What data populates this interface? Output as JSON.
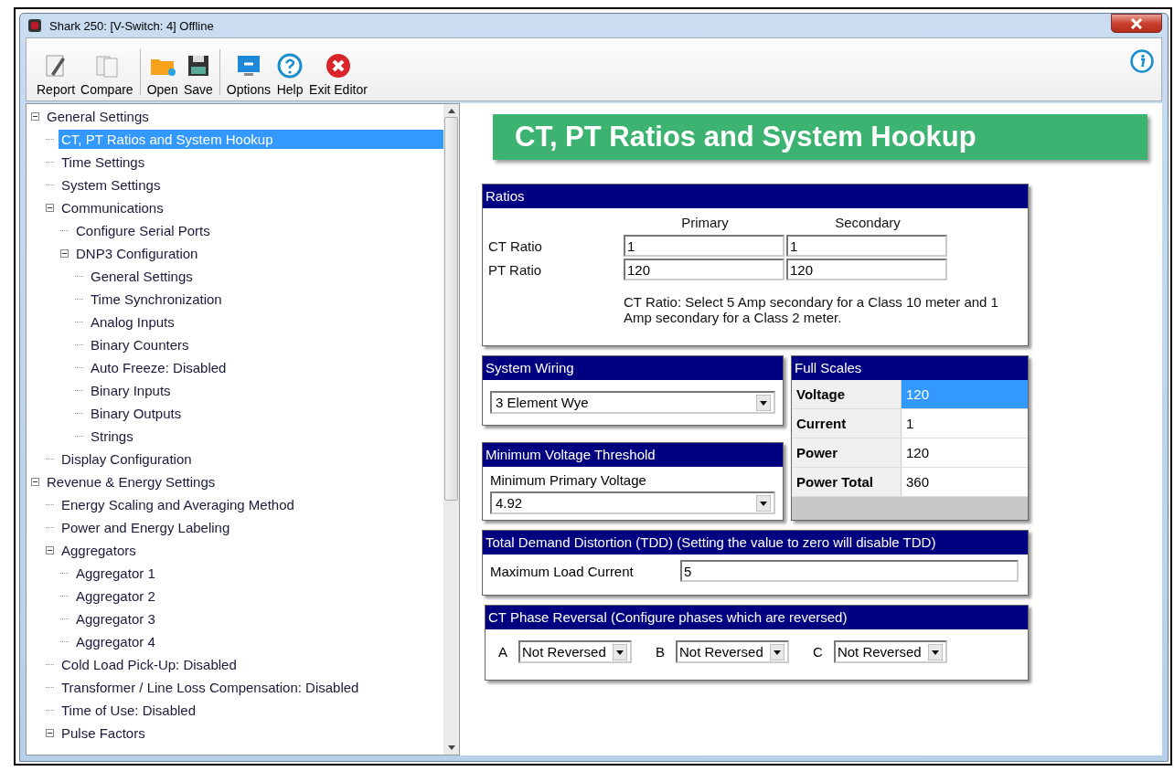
{
  "window": {
    "title": "Shark 250: [V-Switch: 4] Offline"
  },
  "toolbar": {
    "groups": [
      [
        {
          "label": "Report",
          "kind": "report"
        },
        {
          "label": "Compare",
          "kind": "compare"
        }
      ],
      [
        {
          "label": "Open",
          "kind": "open"
        },
        {
          "label": "Save",
          "kind": "save"
        }
      ],
      [
        {
          "label": "Options",
          "kind": "options"
        },
        {
          "label": "Help",
          "kind": "help"
        },
        {
          "label": "Exit Editor",
          "kind": "exit"
        }
      ]
    ]
  },
  "tree": [
    {
      "label": "General Settings",
      "expanded": true,
      "selected": false,
      "children": [
        {
          "label": "CT, PT Ratios and System Hookup",
          "selected": true
        },
        {
          "label": "Time Settings",
          "selected": false
        },
        {
          "label": "System Settings",
          "selected": false
        },
        {
          "label": "Communications",
          "expanded": true,
          "selected": false,
          "children": [
            {
              "label": "Configure Serial Ports",
              "selected": false
            },
            {
              "label": "DNP3 Configuration",
              "expanded": true,
              "selected": false,
              "children": [
                {
                  "label": "General Settings",
                  "selected": false
                },
                {
                  "label": "Time Synchronization",
                  "selected": false
                },
                {
                  "label": "Analog Inputs",
                  "selected": false
                },
                {
                  "label": "Binary Counters",
                  "selected": false
                },
                {
                  "label": "Auto Freeze: Disabled",
                  "selected": false
                },
                {
                  "label": "Binary Inputs",
                  "selected": false
                },
                {
                  "label": "Binary Outputs",
                  "selected": false
                },
                {
                  "label": "Strings",
                  "selected": false
                }
              ]
            }
          ]
        },
        {
          "label": "Display Configuration",
          "selected": false
        }
      ]
    },
    {
      "label": "Revenue & Energy Settings",
      "expanded": true,
      "selected": false,
      "children": [
        {
          "label": "Energy Scaling and Averaging Method",
          "selected": false
        },
        {
          "label": "Power and Energy Labeling",
          "selected": false
        },
        {
          "label": "Aggregators",
          "expanded": true,
          "selected": false,
          "children": [
            {
              "label": "Aggregator 1",
              "selected": false
            },
            {
              "label": "Aggregator 2",
              "selected": false
            },
            {
              "label": "Aggregator 3",
              "selected": false
            },
            {
              "label": "Aggregator 4",
              "selected": false
            }
          ]
        },
        {
          "label": "Cold Load Pick-Up: Disabled",
          "selected": false
        },
        {
          "label": "Transformer / Line Loss Compensation: Disabled",
          "selected": false
        },
        {
          "label": "Time of Use: Disabled",
          "selected": false
        },
        {
          "label": "Pulse Factors",
          "expanded": true,
          "selected": false
        }
      ]
    }
  ],
  "page_title": "CT, PT Ratios and System Hookup",
  "ratios": {
    "title": "Ratios",
    "columns": [
      "Primary",
      "Secondary"
    ],
    "rows": [
      {
        "label": "CT Ratio",
        "values": [
          "1",
          "1"
        ]
      },
      {
        "label": "PT Ratio",
        "values": [
          "120",
          "120"
        ]
      }
    ],
    "note": "CT Ratio: Select 5 Amp secondary for a Class 10 meter and 1 Amp secondary for a Class 2 meter."
  },
  "system_wiring": {
    "title": "System Wiring",
    "value": "3 Element Wye"
  },
  "full_scales": {
    "title": "Full Scales",
    "rows": [
      {
        "label": "Voltage",
        "value": "120",
        "selected": true
      },
      {
        "label": "Current",
        "value": "1",
        "selected": false
      },
      {
        "label": "Power",
        "value": "120",
        "selected": false
      },
      {
        "label": "Power Total",
        "value": "360",
        "selected": false
      }
    ]
  },
  "min_voltage": {
    "title": "Minimum Voltage Threshold",
    "label": "Minimum Primary Voltage",
    "value": "4.92"
  },
  "tdd": {
    "title": "Total Demand Distortion (TDD) (Setting the value to zero will disable TDD)",
    "label": "Maximum Load Current",
    "value": "5"
  },
  "phase_reversal": {
    "title": "CT Phase Reversal (Configure phases which are reversed)",
    "phases": [
      {
        "label": "A",
        "value": "Not Reversed"
      },
      {
        "label": "B",
        "value": "Not Reversed"
      },
      {
        "label": "C",
        "value": "Not Reversed"
      }
    ]
  }
}
